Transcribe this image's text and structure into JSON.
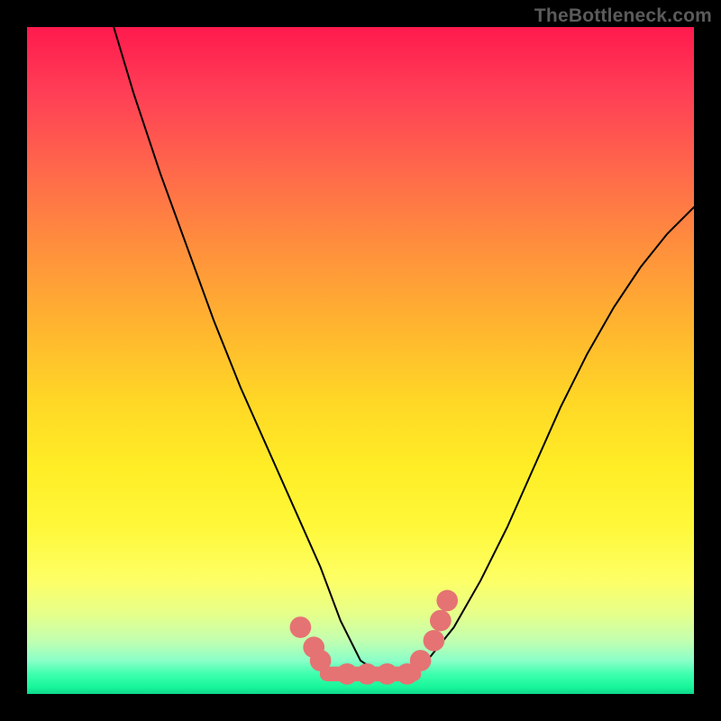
{
  "watermark": {
    "text": "TheBottleneck.com"
  },
  "chart_data": {
    "type": "line",
    "title": "",
    "xlabel": "",
    "ylabel": "",
    "xlim": [
      0,
      100
    ],
    "ylim": [
      0,
      100
    ],
    "grid": false,
    "legend": false,
    "gradient_background": {
      "top_color": "#ff1a4d",
      "bottom_color": "#0fd78a",
      "type": "vertical_heatmap"
    },
    "series": [
      {
        "name": "bottleneck-curve",
        "color": "#000000",
        "x": [
          13,
          16,
          20,
          24,
          28,
          32,
          36,
          40,
          44,
          47,
          50,
          53,
          56,
          60,
          64,
          68,
          72,
          76,
          80,
          84,
          88,
          92,
          96,
          100
        ],
        "values": [
          100,
          90,
          78,
          67,
          56,
          46,
          37,
          28,
          19,
          11,
          5,
          3,
          3,
          5,
          10,
          17,
          25,
          34,
          43,
          51,
          58,
          64,
          69,
          73
        ]
      }
    ],
    "markers": [
      {
        "name": "left-cluster-dot-1",
        "x": 41,
        "y": 10,
        "color": "#e57373",
        "r": 1.6
      },
      {
        "name": "left-cluster-dot-2",
        "x": 43,
        "y": 7,
        "color": "#e57373",
        "r": 1.6
      },
      {
        "name": "left-cluster-dot-3",
        "x": 44,
        "y": 5,
        "color": "#e57373",
        "r": 1.6
      },
      {
        "name": "flat-dot-1",
        "x": 48,
        "y": 3,
        "color": "#e57373",
        "r": 1.6
      },
      {
        "name": "flat-dot-2",
        "x": 51,
        "y": 3,
        "color": "#e57373",
        "r": 1.6
      },
      {
        "name": "flat-dot-3",
        "x": 54,
        "y": 3,
        "color": "#e57373",
        "r": 1.6
      },
      {
        "name": "flat-dot-4",
        "x": 57,
        "y": 3,
        "color": "#e57373",
        "r": 1.6
      },
      {
        "name": "right-cluster-dot-1",
        "x": 59,
        "y": 5,
        "color": "#e57373",
        "r": 1.6
      },
      {
        "name": "right-cluster-dot-2",
        "x": 61,
        "y": 8,
        "color": "#e57373",
        "r": 1.6
      },
      {
        "name": "right-cluster-dot-3",
        "x": 62,
        "y": 11,
        "color": "#e57373",
        "r": 1.6
      },
      {
        "name": "right-cluster-dot-4",
        "x": 63,
        "y": 14,
        "color": "#e57373",
        "r": 1.6
      }
    ],
    "flat_band": {
      "name": "valley-flat-highlight",
      "x_start": 45,
      "x_end": 58,
      "y": 3,
      "color": "#e57373",
      "thickness": 2.2
    }
  }
}
